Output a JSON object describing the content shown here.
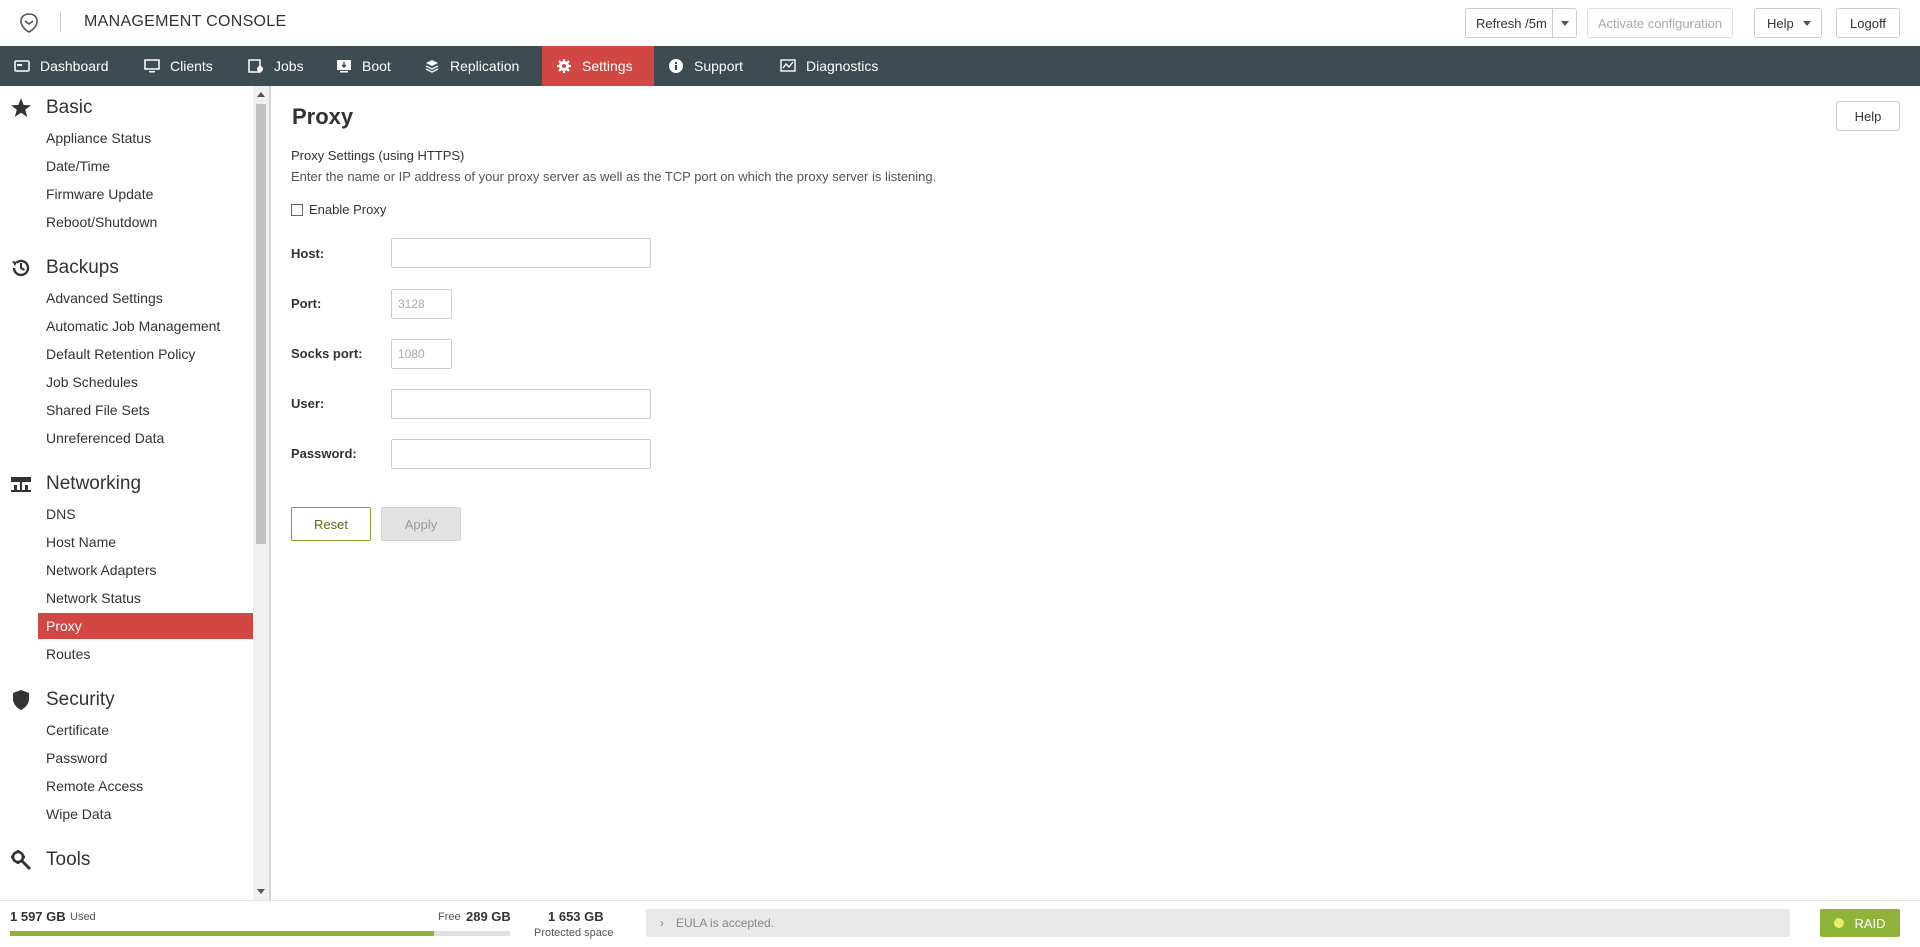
{
  "header": {
    "app_title": "MANAGEMENT CONSOLE",
    "refresh_label": "Refresh /5m",
    "activate_label": "Activate configuration",
    "help_label": "Help",
    "logoff_label": "Logoff"
  },
  "nav": {
    "items": [
      {
        "label": "Dashboard",
        "icon": "dashboard-icon"
      },
      {
        "label": "Clients",
        "icon": "monitor-icon"
      },
      {
        "label": "Jobs",
        "icon": "jobs-icon"
      },
      {
        "label": "Boot",
        "icon": "boot-icon"
      },
      {
        "label": "Replication",
        "icon": "replication-icon"
      },
      {
        "label": "Settings",
        "icon": "gear-icon",
        "active": true
      },
      {
        "label": "Support",
        "icon": "info-icon"
      },
      {
        "label": "Diagnostics",
        "icon": "diagnostics-icon"
      }
    ]
  },
  "sidebar": {
    "groups": [
      {
        "title": "Basic",
        "icon": "star-icon",
        "items": [
          "Appliance Status",
          "Date/Time",
          "Firmware Update",
          "Reboot/Shutdown"
        ]
      },
      {
        "title": "Backups",
        "icon": "history-icon",
        "items": [
          "Advanced Settings",
          "Automatic Job Management",
          "Default Retention Policy",
          "Job Schedules",
          "Shared File Sets",
          "Unreferenced Data"
        ]
      },
      {
        "title": "Networking",
        "icon": "network-icon",
        "items": [
          "DNS",
          "Host Name",
          "Network Adapters",
          "Network Status",
          "Proxy",
          "Routes"
        ]
      },
      {
        "title": "Security",
        "icon": "shield-icon",
        "items": [
          "Certificate",
          "Password",
          "Remote Access",
          "Wipe Data"
        ]
      },
      {
        "title": "Tools",
        "icon": "tools-icon",
        "items": []
      }
    ],
    "active_item": "Proxy"
  },
  "main": {
    "title": "Proxy",
    "help_label": "Help",
    "section_title": "Proxy Settings (using HTTPS)",
    "section_desc": "Enter the name or IP address of your proxy server as well as the TCP port on which the proxy server is listening.",
    "enable_label": "Enable Proxy",
    "enable_checked": false,
    "fields": {
      "host": {
        "label": "Host:",
        "value": ""
      },
      "port": {
        "label": "Port:",
        "placeholder": "3128"
      },
      "socks": {
        "label": "Socks port:",
        "placeholder": "1080"
      },
      "user": {
        "label": "User:",
        "value": ""
      },
      "password": {
        "label": "Password:",
        "value": ""
      }
    },
    "reset_label": "Reset",
    "apply_label": "Apply"
  },
  "footer": {
    "used_value": "1 597 GB",
    "used_label": "Used",
    "free_label": "Free",
    "free_value": "289 GB",
    "used_fraction": 0.847,
    "protected_value": "1 653 GB",
    "protected_label": "Protected space",
    "eula_text": "EULA is accepted.",
    "raid_label": "RAID",
    "colors": {
      "accent": "#d04743",
      "nav_bg": "#3d4c51",
      "ok_green": "#8fb23a"
    }
  }
}
